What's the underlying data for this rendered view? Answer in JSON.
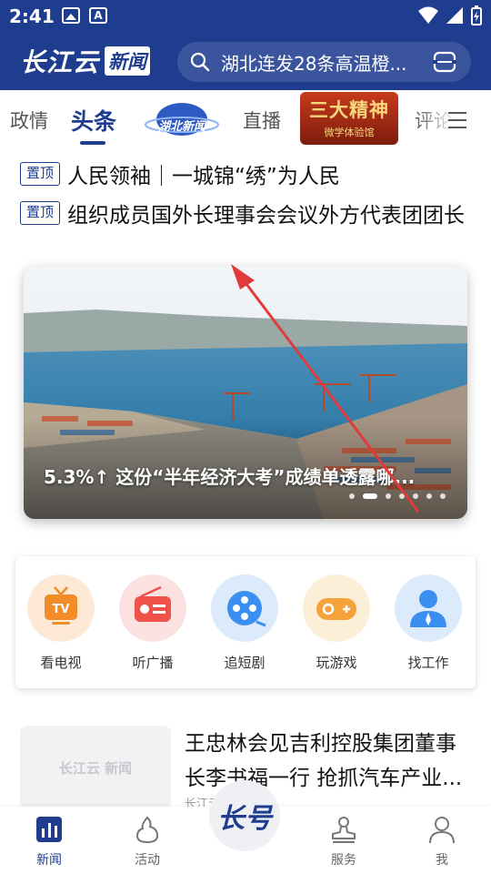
{
  "status_bar": {
    "time": "2:41"
  },
  "header": {
    "logo_main": "长江云",
    "logo_box": "新闻",
    "search_placeholder": "湖北连发28条高温橙..."
  },
  "tabs": {
    "items": [
      "政情",
      "头条",
      "直播",
      "评论"
    ],
    "active": "头条",
    "special_logo_1": "湖北新闻",
    "special_logo_2_title": "三大精神",
    "special_logo_2_sub": "微学体验馆"
  },
  "pinned": [
    {
      "badge": "置顶",
      "title": "人民领袖｜一城锦“绣”为人民"
    },
    {
      "badge": "置顶",
      "title": "组织成员国外长理事会会议外方代表团团长"
    }
  ],
  "banner": {
    "caption": "5.3%↑ 这份“半年经济大考”成绩单透露哪...",
    "slide_count": 7,
    "active_slide": 1
  },
  "services": [
    {
      "label": "看电视",
      "icon": "tv-icon",
      "color": "#f28c28",
      "bg": "#fde9d5"
    },
    {
      "label": "听广播",
      "icon": "radio-icon",
      "color": "#f0524a",
      "bg": "#fbe2e1"
    },
    {
      "label": "追短剧",
      "icon": "film-reel-icon",
      "color": "#3b8ff0",
      "bg": "#dcebfc"
    },
    {
      "label": "玩游戏",
      "icon": "gamepad-icon",
      "color": "#f5a23a",
      "bg": "#fdeed8"
    },
    {
      "label": "找工作",
      "icon": "job-person-icon",
      "color": "#3b8ff0",
      "bg": "#dcebfc"
    }
  ],
  "news": {
    "thumb_placeholder": "长江云 新闻",
    "title_line1": "王忠林会见吉利控股集团董事",
    "title_line2": "长李书福一行 抢抓汽车产业...",
    "source": "长江云 ..."
  },
  "bottom_nav": {
    "items": [
      {
        "label": "新闻",
        "icon": "news-chart-icon",
        "active": true
      },
      {
        "label": "活动",
        "icon": "activity-icon",
        "active": false
      },
      {
        "label": "服务",
        "icon": "service-stamp-icon",
        "active": false
      },
      {
        "label": "我",
        "icon": "profile-icon",
        "active": false
      }
    ],
    "center_label": "长号"
  },
  "colors": {
    "brand": "#1e3d8f",
    "annotation_arrow": "#e03a3a"
  }
}
